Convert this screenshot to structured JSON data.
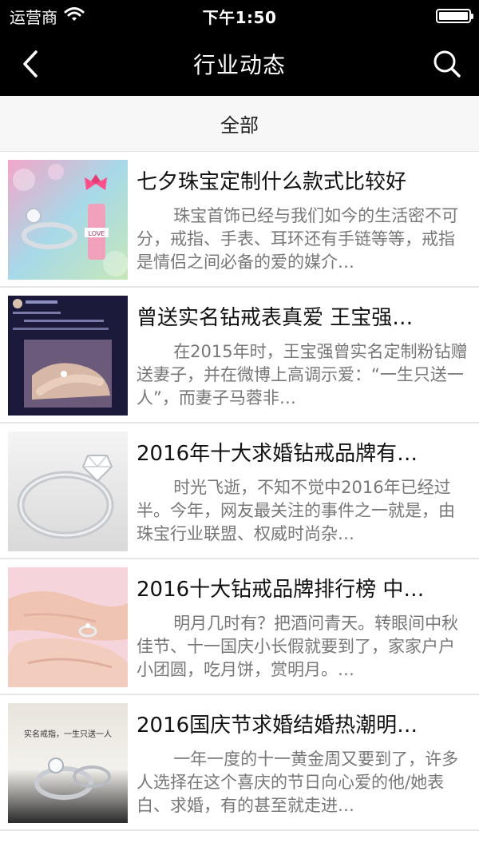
{
  "status_bar": {
    "carrier": "运营商",
    "time": "下午1:50",
    "wifi_icon": "wifi-icon",
    "battery_icon": "battery-icon"
  },
  "nav": {
    "title": "行业动态",
    "back_icon": "chevron-left-icon",
    "search_icon": "search-icon",
    "colors": {
      "background": "#000000",
      "text": "#ffffff"
    }
  },
  "filter": {
    "label": "全部"
  },
  "articles": [
    {
      "title": "七夕珠宝定制什么款式比较好",
      "summary": "珠宝首饰已经与我们如今的生活密不可分，戒指、手表、耳环还有手链等等，戒指是情侣之间必备的爱的媒介…"
    },
    {
      "title": "曾送实名钻戒表真爱 王宝强…",
      "summary": "在2015年时，王宝强曾实名定制粉钻赠送妻子，并在微博上高调示爱：“一生只送一人”，而妻子马蓉非…"
    },
    {
      "title": "2016年十大求婚钻戒品牌有…",
      "summary": "时光飞逝，不知不觉中2016年已经过半。今年，网友最关注的事件之一就是，由珠宝行业联盟、权威时尚杂…"
    },
    {
      "title": "2016十大钻戒品牌排行榜 中…",
      "summary": "明月几时有？把酒问青天。转眼间中秋佳节、十一国庆小长假就要到了，家家户户小团圆，吃月饼，赏明月。…"
    },
    {
      "title": "2016国庆节求婚结婚热潮明…",
      "summary": "一年一度的十一黄金周又要到了，许多人选择在这个喜庆的节日向心爱的他/她表白、求婚，有的甚至就走进…",
      "thumb_caption": "实名戒指，一生只送一人"
    }
  ]
}
